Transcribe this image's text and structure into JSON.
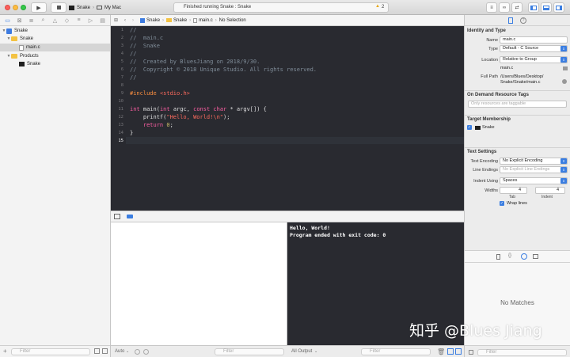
{
  "toolbar": {
    "scheme_target": "Snake",
    "scheme_device": "My Mac",
    "activity_text": "Finished running Snake : Snake",
    "warning_count": "2"
  },
  "navigator": {
    "project": "Snake",
    "group": "Snake",
    "file": "main.c",
    "products_group": "Products",
    "product": "Snake",
    "filter_placeholder": "Filter"
  },
  "jumpbar": {
    "crumbs": [
      "Snake",
      "Snake",
      "main.c",
      "No Selection"
    ]
  },
  "editor": {
    "line_numbers": [
      "1",
      "2",
      "3",
      "4",
      "5",
      "6",
      "7",
      "8",
      "9",
      "10",
      "11",
      "12",
      "13",
      "14",
      "15"
    ],
    "lines": {
      "l1": "//",
      "l2": "//  main.c",
      "l3": "//  Snake",
      "l4": "//",
      "l5": "//  Created by BluesJiang on 2018/9/30.",
      "l6": "//  Copyright © 2018 Unique Studio. All rights reserved.",
      "l7": "//",
      "l9_kw": "#include",
      "l9_hdr": "<stdio.h>",
      "l11_kw": "int",
      "l11_rest": " main(",
      "l11_kw2": "int",
      "l11_rest2": " argc, ",
      "l11_kw3": "const char",
      "l11_rest3": " * argv[]) {",
      "l12_fn": "    printf(",
      "l12_str": "\"Hello, World!\\n\"",
      "l12_end": ");",
      "l13_kw": "    return",
      "l13_num": "0",
      "l13_end": ";",
      "l14": "}"
    }
  },
  "console": {
    "line1": "Hello, World!",
    "line2": "Program ended with exit code: 0"
  },
  "debug_bottom": {
    "auto_label": "Auto",
    "filter_left": "Filter",
    "output_label": "All Output",
    "filter_right": "Filter"
  },
  "inspector": {
    "identity_title": "Identity and Type",
    "name_label": "Name",
    "name_value": "main.c",
    "type_label": "Type",
    "type_value": "Default - C Source",
    "location_label": "Location",
    "location_value": "Relative to Group",
    "location_file": "main.c",
    "fullpath_label": "Full Path",
    "fullpath_value_1": "/Users/Blues/Desktop/",
    "fullpath_value_2": "Snake/Snake/main.c",
    "odr_title": "On Demand Resource Tags",
    "odr_placeholder": "Only resources are taggable",
    "target_title": "Target Membership",
    "target_name": "Snake",
    "text_title": "Text Settings",
    "encoding_label": "Text Encoding",
    "encoding_value": "No Explicit Encoding",
    "line_endings_label": "Line Endings",
    "line_endings_value": "No Explicit Line Endings",
    "indent_label": "Indent Using",
    "indent_value": "Spaces",
    "widths_label": "Widths",
    "tab_width": "4",
    "indent_width": "4",
    "tab_label": "Tab",
    "indent_sub_label": "Indent",
    "wrap_label": "Wrap lines",
    "no_matches": "No Matches",
    "filter_placeholder": "Filter"
  },
  "watermark": "知乎 @Blues Jiang"
}
